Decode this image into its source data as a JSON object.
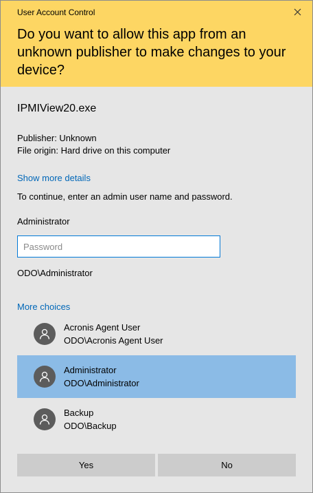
{
  "window": {
    "title": "User Account Control"
  },
  "header": {
    "question": "Do you want to allow this app from an unknown publisher to make changes to your device?"
  },
  "app": {
    "name": "IPMIView20.exe",
    "publisher": "Publisher: Unknown",
    "file_origin": "File origin: Hard drive on this computer"
  },
  "links": {
    "show_more": "Show more details",
    "more_choices": "More choices"
  },
  "credentials": {
    "instruction": "To continue, enter an admin user name and password.",
    "username": "Administrator",
    "password_placeholder": "Password",
    "password_value": "",
    "domain": "ODO\\Administrator"
  },
  "accounts": [
    {
      "name": "Acronis Agent User",
      "domain": "ODO\\Acronis Agent User",
      "selected": false
    },
    {
      "name": "Administrator",
      "domain": "ODO\\Administrator",
      "selected": true
    },
    {
      "name": "Backup",
      "domain": "ODO\\Backup",
      "selected": false
    }
  ],
  "buttons": {
    "yes": "Yes",
    "no": "No"
  },
  "colors": {
    "header_bg": "#fdd663",
    "link": "#0067b8",
    "selected_bg": "#8bbbe6",
    "dialog_bg": "#e6e6e6"
  },
  "icons": {
    "close": "close-icon",
    "avatar": "user-icon"
  }
}
